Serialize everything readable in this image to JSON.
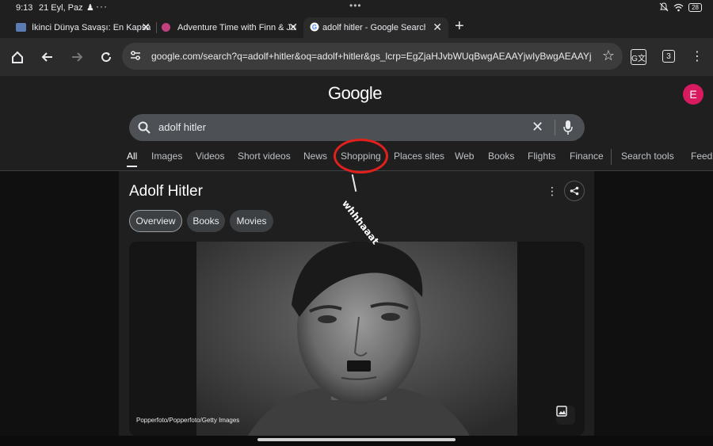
{
  "status_bar": {
    "time": "9:13",
    "date": "21 Eyl, Paz",
    "battery": "28"
  },
  "tabs": [
    {
      "title": "İkinci Dünya Savaşı: En Kapsamlı",
      "favicon": "flag-icon",
      "color": "#5b7bb5"
    },
    {
      "title": "Adventure Time with Finn & Jake",
      "favicon": "orb-icon",
      "color": "#c04080"
    },
    {
      "title": "adolf hitler - Google Search",
      "favicon": "google-icon",
      "color": "#ffffff",
      "active": true
    }
  ],
  "toolbar": {
    "url": "google.com/search?q=adolf+hitler&oq=adolf+hitler&gs_lcrp=EgZjaHJvbWUqBwgAEAAYjwIyBwgAEAAYjwIyBwgBEC",
    "tab_count": "3"
  },
  "google": {
    "logo": "Google",
    "avatar_letter": "E",
    "query": "adolf hitler",
    "nav": [
      "All",
      "Images",
      "Videos",
      "Short videos",
      "News",
      "Shopping",
      "Places sites",
      "Web",
      "Books",
      "Flights",
      "Finance",
      "Search tools",
      "Feedb"
    ]
  },
  "knowledge_panel": {
    "title": "Adolf Hitler",
    "chips": [
      "Overview",
      "Books",
      "Movies"
    ],
    "image_credit": "Popperfoto/Popperfoto/Getty Images"
  },
  "annotation": {
    "text": "whhhaaat",
    "color": "#e0201c"
  }
}
